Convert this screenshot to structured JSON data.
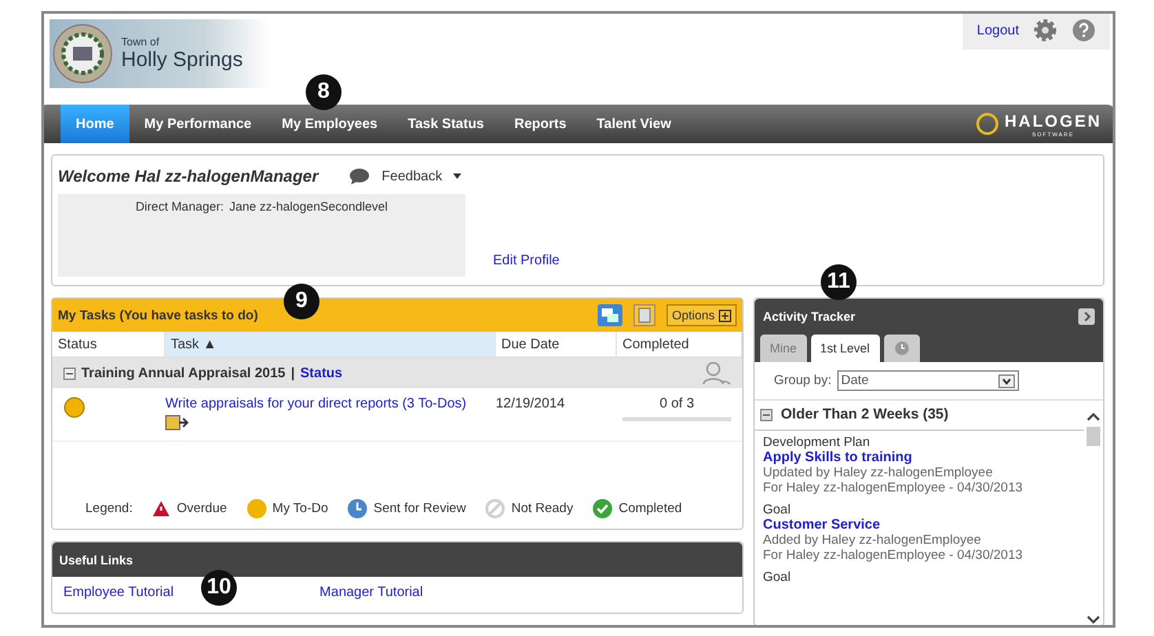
{
  "logo": {
    "small": "Town of",
    "big": "Holly Springs"
  },
  "header_links": {
    "logout": "Logout"
  },
  "nav": [
    {
      "label": "Home",
      "selected": true
    },
    {
      "label": "My Performance",
      "selected": false
    },
    {
      "label": "My Employees",
      "selected": false
    },
    {
      "label": "Task Status",
      "selected": false
    },
    {
      "label": "Reports",
      "selected": false
    },
    {
      "label": "Talent View",
      "selected": false
    }
  ],
  "brand": {
    "name": "HALOGEN",
    "sub": "SOFTWARE"
  },
  "welcome": {
    "title": "Welcome Hal zz-halogenManager",
    "feedback": "Feedback",
    "manager_label": "Direct Manager:",
    "manager": "Jane zz-halogenSecondlevel",
    "edit_profile": "Edit Profile"
  },
  "tasks": {
    "title": "My Tasks (You have tasks to do)",
    "options": "Options",
    "columns": [
      "Status",
      "Task ▲",
      "Due Date",
      "Completed"
    ],
    "group": {
      "title": "Training Annual Appraisal 2015",
      "separator": "|",
      "link": "Status"
    },
    "rows": [
      {
        "task": "Write appraisals for your direct reports (3 To-Dos)",
        "due": "12/19/2014",
        "completed": "0 of 3"
      }
    ],
    "legend_label": "Legend:",
    "legend": [
      {
        "kind": "overdue",
        "label": "Overdue"
      },
      {
        "kind": "todo",
        "label": "My To-Do"
      },
      {
        "kind": "review",
        "label": "Sent for Review"
      },
      {
        "kind": "notready",
        "label": "Not Ready"
      },
      {
        "kind": "completed",
        "label": "Completed"
      }
    ]
  },
  "useful_links": {
    "title": "Useful Links",
    "links": [
      "Employee Tutorial",
      "Manager Tutorial"
    ]
  },
  "activity": {
    "title": "Activity Tracker",
    "tabs": [
      {
        "kind": "text",
        "label": "Mine",
        "selected": false
      },
      {
        "kind": "text",
        "label": "1st Level",
        "selected": true
      },
      {
        "kind": "icon",
        "selected": false
      }
    ],
    "group_by_label": "Group by:",
    "group_by": "Date",
    "section": "Older Than 2 Weeks (35)",
    "items": [
      {
        "type": "Development Plan",
        "title": "Apply Skills to training",
        "line1": "Updated by Haley zz-halogenEmployee",
        "line2": "For Haley zz-halogenEmployee - 04/30/2013"
      },
      {
        "type": "Goal",
        "title": "Customer Service",
        "line1": "Added by Haley zz-halogenEmployee",
        "line2": "For Haley zz-halogenEmployee - 04/30/2013"
      },
      {
        "type": "Goal"
      }
    ]
  },
  "callouts": [
    "8",
    "9",
    "10",
    "11"
  ]
}
